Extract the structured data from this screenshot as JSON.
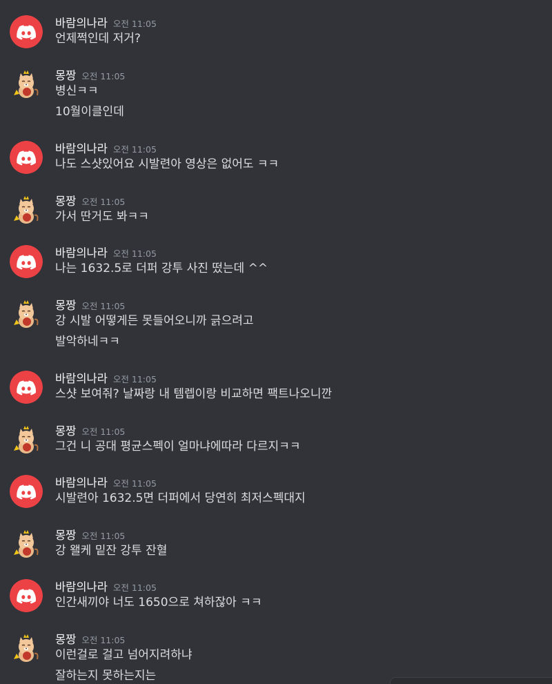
{
  "users": {
    "discord": {
      "name": "바람의나라"
    },
    "cat": {
      "name": "몽짱"
    }
  },
  "time": "오전 11:05",
  "messages": [
    {
      "author": "바람의나라",
      "time": "오전 11:05",
      "avatar": "discord-logo-icon",
      "lines": [
        "언제쩍인데 저거?"
      ]
    },
    {
      "author": "몽짱",
      "time": "오전 11:05",
      "avatar": "cartoon-cat-avatar-icon",
      "lines": [
        "병신ㅋㅋ",
        "10월이클인데"
      ]
    },
    {
      "author": "바람의나라",
      "time": "오전 11:05",
      "avatar": "discord-logo-icon",
      "lines": [
        "나도 스샷있어요 시발련아 영상은 없어도 ㅋㅋ"
      ]
    },
    {
      "author": "몽짱",
      "time": "오전 11:05",
      "avatar": "cartoon-cat-avatar-icon",
      "lines": [
        "가서 딴거도 봐ㅋㅋ"
      ]
    },
    {
      "author": "바람의나라",
      "time": "오전 11:05",
      "avatar": "discord-logo-icon",
      "lines": [
        "나는 1632.5로 더퍼 강투 사진 떴는데 ^^"
      ]
    },
    {
      "author": "몽짱",
      "time": "오전 11:05",
      "avatar": "cartoon-cat-avatar-icon",
      "lines": [
        "강 시발 어떻게든 못들어오니까 긁으려고",
        "발악하네ㅋㅋ"
      ]
    },
    {
      "author": "바람의나라",
      "time": "오전 11:05",
      "avatar": "discord-logo-icon",
      "lines": [
        "스샷 보여줘? 날짜랑 내 템렙이랑 비교하면 팩트나오니깐"
      ]
    },
    {
      "author": "몽짱",
      "time": "오전 11:05",
      "avatar": "cartoon-cat-avatar-icon",
      "lines": [
        "그건 니 공대 평균스펙이 얼마냐에따라 다르지ㅋㅋ"
      ]
    },
    {
      "author": "바람의나라",
      "time": "오전 11:05",
      "avatar": "discord-logo-icon",
      "lines": [
        "시발련아 1632.5면 더퍼에서 당연히 최저스펙대지"
      ]
    },
    {
      "author": "몽짱",
      "time": "오전 11:05",
      "avatar": "cartoon-cat-avatar-icon",
      "lines": [
        "강 왤케 밑잔 강투 잔혈"
      ]
    },
    {
      "author": "바람의나라",
      "time": "오전 11:05",
      "avatar": "discord-logo-icon",
      "lines": [
        "인간새끼야 너도 1650으로 쳐하잖아 ㅋㅋ"
      ]
    },
    {
      "author": "몽짱",
      "time": "오전 11:05",
      "avatar": "cartoon-cat-avatar-icon",
      "lines": [
        "이런걸로 걸고 넘어지려하냐",
        "잘하는지 못하는지는"
      ]
    }
  ],
  "colors": {
    "background": "#313338",
    "discord_avatar": "#ed4245",
    "username": "#f2f3f5",
    "timestamp": "#949ba4",
    "text": "#dbdee1"
  }
}
